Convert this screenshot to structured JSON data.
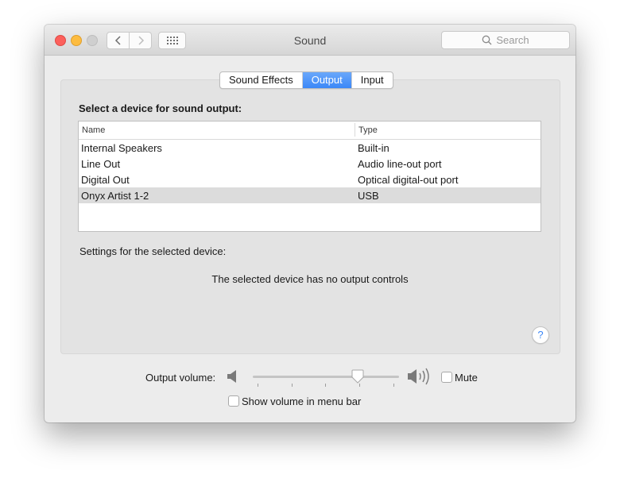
{
  "window": {
    "title": "Sound",
    "search_placeholder": "Search"
  },
  "tabs": [
    {
      "label": "Sound Effects",
      "active": false
    },
    {
      "label": "Output",
      "active": true
    },
    {
      "label": "Input",
      "active": false
    }
  ],
  "output": {
    "heading": "Select a device for sound output:",
    "columns": [
      "Name",
      "Type"
    ],
    "devices": [
      {
        "name": "Internal Speakers",
        "type": "Built-in",
        "selected": false
      },
      {
        "name": "Line Out",
        "type": "Audio line-out port",
        "selected": false
      },
      {
        "name": "Digital Out",
        "type": "Optical digital-out port",
        "selected": false
      },
      {
        "name": "Onyx Artist 1-2",
        "type": "USB",
        "selected": true
      }
    ],
    "settings_label": "Settings for the selected device:",
    "no_controls_message": "The selected device has no output controls",
    "help_label": "?"
  },
  "volume": {
    "label": "Output volume:",
    "level": 0.73,
    "mute_label": "Mute",
    "mute_checked": false,
    "show_in_menu_bar_label": "Show volume in menu bar",
    "show_in_menu_bar_checked": false
  },
  "colors": {
    "accent": "#3b87f7",
    "close": "#fc605c",
    "minimize": "#fdbc40"
  }
}
